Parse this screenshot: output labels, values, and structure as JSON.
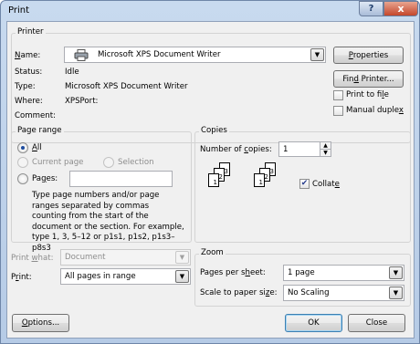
{
  "window": {
    "title": "Print"
  },
  "title_buttons": {
    "help": "?",
    "close": "x"
  },
  "printer": {
    "group_label": "Printer",
    "name_label": "Name:",
    "name_value": "Microsoft XPS Document Writer",
    "properties_button": "Properties",
    "status_label": "Status:",
    "status_value": "Idle",
    "type_label": "Type:",
    "type_value": "Microsoft XPS Document Writer",
    "where_label": "Where:",
    "where_value": "XPSPort:",
    "comment_label": "Comment:",
    "comment_value": "",
    "find_printer_button": "Find Printer...",
    "print_to_file_label": "Print to file",
    "print_to_file_checked": false,
    "manual_duplex_label": "Manual duplex",
    "manual_duplex_checked": false
  },
  "page_range": {
    "group_label": "Page range",
    "all_label": "All",
    "current_page_label": "Current page",
    "selection_label": "Selection",
    "pages_label": "Pages:",
    "pages_value": "",
    "selected": "all",
    "help_text": "Type page numbers and/or page ranges separated by commas counting from the start of the document or the section. For example, type 1, 3, 5–12 or p1s1, p1s2, p1s3–p8s3"
  },
  "copies": {
    "group_label": "Copies",
    "number_label": "Number of copies:",
    "number_value": "1",
    "collate_label": "Collate",
    "collate_checked": true,
    "collate_icon": "collate-pages-icon"
  },
  "print_what": {
    "label": "Print what:",
    "value": "Document"
  },
  "print": {
    "label": "Print:",
    "value": "All pages in range"
  },
  "zoom": {
    "group_label": "Zoom",
    "pages_per_sheet_label": "Pages per sheet:",
    "pages_per_sheet_value": "1 page",
    "scale_label": "Scale to paper size:",
    "scale_value": "No Scaling"
  },
  "buttons": {
    "options": "Options...",
    "ok": "OK",
    "close": "Close"
  }
}
